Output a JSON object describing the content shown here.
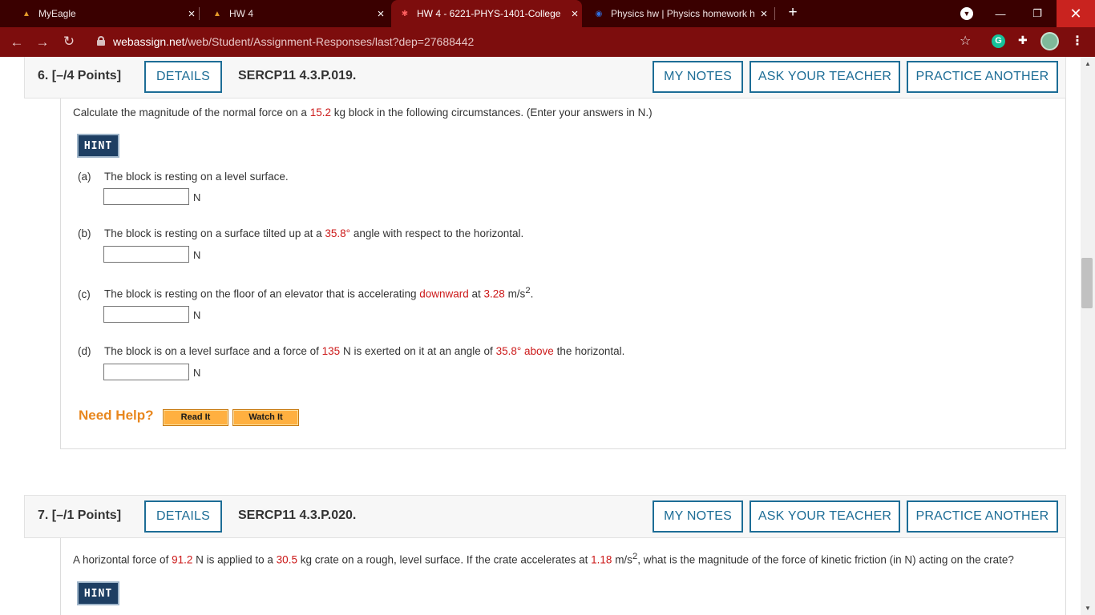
{
  "browser": {
    "tabs": [
      {
        "title": "MyEagle"
      },
      {
        "title": "HW 4"
      },
      {
        "title": "HW 4 - 6221-PHYS-1401-College"
      },
      {
        "title": "Physics hw | Physics homework h"
      }
    ],
    "url_host": "webassign.net",
    "url_path": "/web/Student/Assignment-Responses/last?dep=27688442"
  },
  "buttons": {
    "details": "DETAILS",
    "my_notes": "MY NOTES",
    "ask_teacher": "ASK YOUR TEACHER",
    "practice_another": "PRACTICE ANOTHER",
    "hint": "HINT"
  },
  "q6": {
    "number": "6.  [–/4 Points]",
    "code": "SERCP11 4.3.P.019.",
    "prompt": {
      "t1": "Calculate the magnitude of the normal force on a ",
      "mass": "15.2",
      "t2": " kg block in the following circumstances. (Enter your answers in N.)"
    },
    "parts": {
      "a": {
        "label": "(a)",
        "t1": "The block is resting on a level surface."
      },
      "b": {
        "label": "(b)",
        "t1": "The block is resting on a surface tilted up at a ",
        "angle": "35.8°",
        "t2": " angle with respect to the horizontal."
      },
      "c": {
        "label": "(c)",
        "t1": "The block is resting on the floor of an elevator that is accelerating ",
        "dir": "downward",
        "t2": " at ",
        "accel": "3.28",
        "t3": " m/s",
        "sup": "2",
        "t4": "."
      },
      "d": {
        "label": "(d)",
        "t1": "The block is on a level surface and a force of ",
        "force": "135",
        "t2": " N is exerted on it at an angle of ",
        "angle": "35.8°",
        "t3": " ",
        "dir": "above",
        "t4": " the horizontal."
      }
    },
    "unit": "N",
    "need_help": "Need Help?",
    "read_it": "Read It",
    "watch_it": "Watch It"
  },
  "q7": {
    "number": "7.  [–/1 Points]",
    "code": "SERCP11 4.3.P.020.",
    "prompt": {
      "t1": "A horizontal force of ",
      "force": "91.2",
      "t2": " N is applied to a ",
      "mass": "30.5",
      "t3": " kg crate on a rough, level surface. If the crate accelerates at ",
      "accel": "1.18",
      "t4": " m/s",
      "sup": "2",
      "t5": ", what is the magnitude of the force of kinetic friction (in N) acting on the crate?"
    }
  },
  "colors": {
    "accent": "#1d6d96",
    "highlight": "#cc1a1a",
    "chrome": "#7d0d0d",
    "hint": "#1e3f63",
    "help": "#ffb040"
  }
}
